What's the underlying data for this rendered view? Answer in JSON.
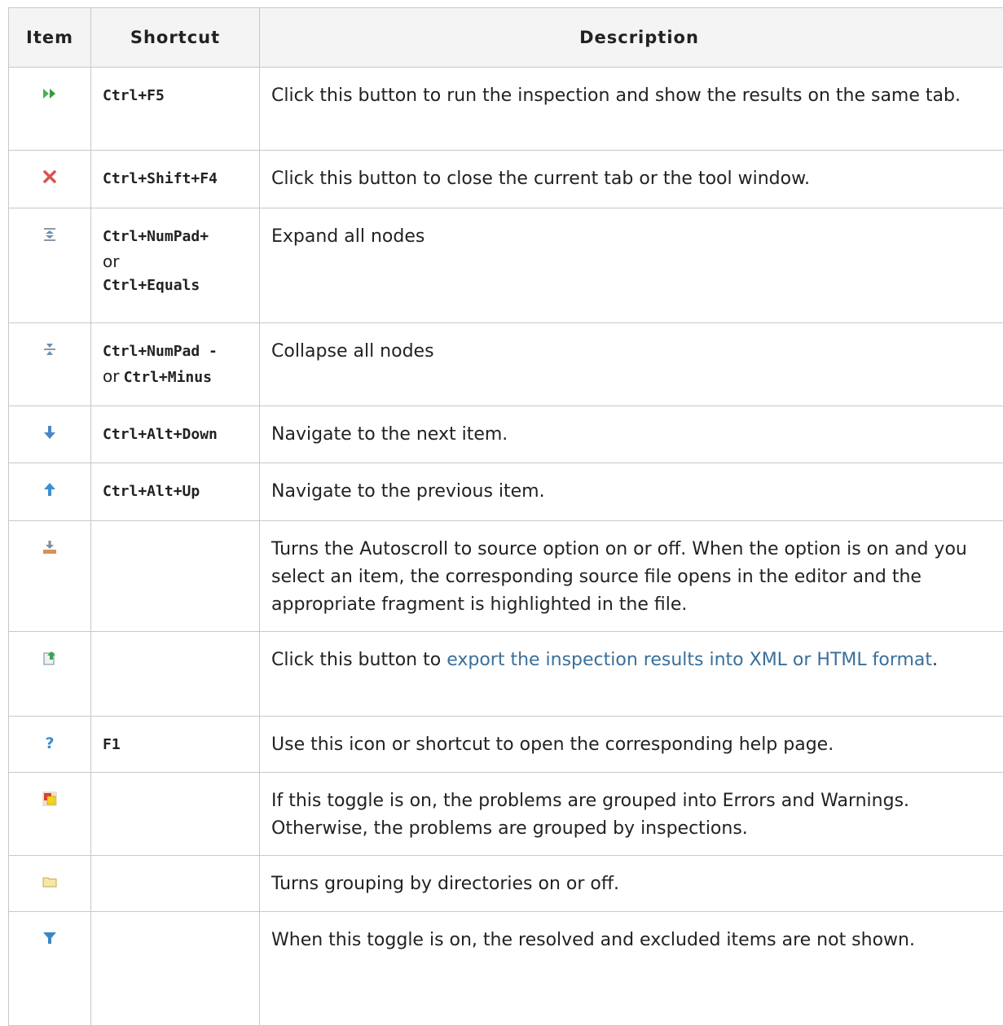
{
  "table": {
    "headers": {
      "item": "Item",
      "shortcut": "Shortcut",
      "description": "Description"
    },
    "rows": [
      {
        "icon": "rerun-icon",
        "shortcut": "Ctrl+F5",
        "description": "Click this button to run the inspection and show the results on the same tab."
      },
      {
        "icon": "close-icon",
        "shortcut": "Ctrl+Shift+F4",
        "description": "Click this button to close the current tab or the tool window."
      },
      {
        "icon": "expand-all-icon",
        "shortcut": "Ctrl+NumPad+",
        "or": "or",
        "shortcut2": "Ctrl+Equals",
        "description": "Expand all nodes"
      },
      {
        "icon": "collapse-all-icon",
        "shortcut": "Ctrl+NumPad -",
        "or": "or",
        "shortcut2": "Ctrl+Minus",
        "description": "Collapse all nodes"
      },
      {
        "icon": "arrow-down-icon",
        "shortcut": "Ctrl+Alt+Down",
        "description": "Navigate to the next item."
      },
      {
        "icon": "arrow-up-icon",
        "shortcut": "Ctrl+Alt+Up",
        "description": "Navigate to the previous item."
      },
      {
        "icon": "autoscroll-to-source-icon",
        "shortcut": "",
        "description": "Turns the Autoscroll to source option on or off. When the option is on and you select an item, the corresponding source file opens in the editor and the appropriate fragment is highlighted in the file."
      },
      {
        "icon": "export-icon",
        "shortcut": "",
        "description_before": "Click this button to ",
        "link_text": "export the inspection results into XML or HTML format",
        "description_after": "."
      },
      {
        "icon": "help-icon",
        "shortcut": "F1",
        "description": "Use this icon or shortcut to open the corresponding help page."
      },
      {
        "icon": "group-by-severity-icon",
        "shortcut": "",
        "description": "If this toggle is on, the problems are grouped into Errors and Warnings. Otherwise, the problems are grouped by inspections."
      },
      {
        "icon": "folder-icon",
        "shortcut": "",
        "description": "Turns grouping by directories on or off."
      },
      {
        "icon": "filter-icon",
        "shortcut": "",
        "description": "When this toggle is on, the resolved and excluded items are not shown."
      }
    ]
  },
  "colors": {
    "link": "#3a6f9a",
    "border": "#c8c8c8",
    "header_bg": "#f4f4f4"
  }
}
